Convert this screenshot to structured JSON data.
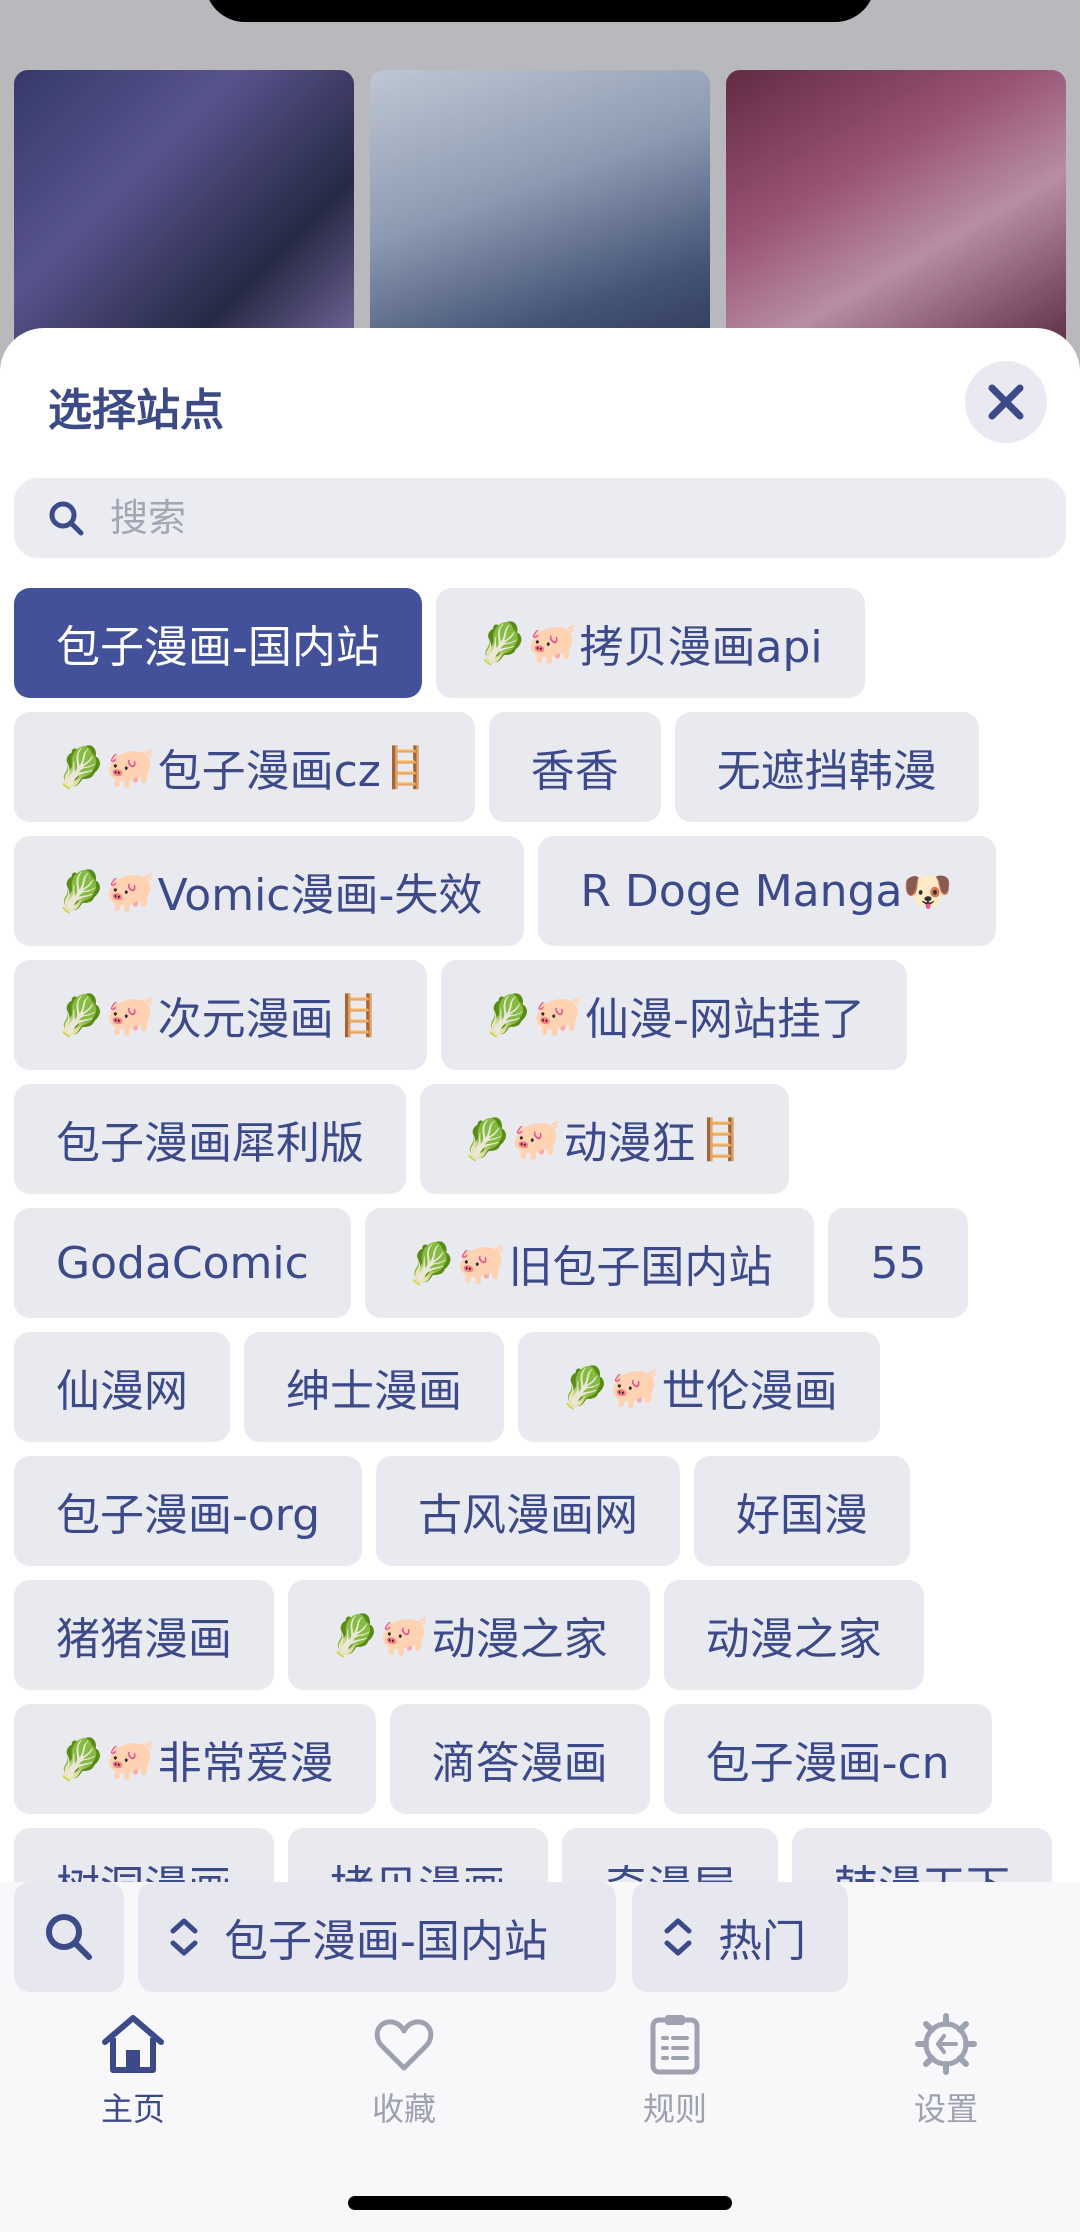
{
  "sheet": {
    "title": "选择站点",
    "search_placeholder": "搜索"
  },
  "sites": [
    {
      "label": "包子漫画-国内站",
      "prefix": "",
      "suffix": "",
      "active": true
    },
    {
      "label": "拷贝漫画api",
      "prefix": "🥬🐖",
      "suffix": ""
    },
    {
      "label": "包子漫画cz",
      "prefix": "🥬🐖",
      "suffix": "🪜"
    },
    {
      "label": "香香",
      "prefix": "",
      "suffix": ""
    },
    {
      "label": "无遮挡韩漫",
      "prefix": "",
      "suffix": ""
    },
    {
      "label": "Vomic漫画-失效",
      "prefix": "🥬🐖",
      "suffix": ""
    },
    {
      "label": "R Doge Manga",
      "prefix": "",
      "suffix": "🐶"
    },
    {
      "label": "次元漫画",
      "prefix": "🥬🐖",
      "suffix": "🪜"
    },
    {
      "label": "仙漫-网站挂了",
      "prefix": "🥬🐖",
      "suffix": ""
    },
    {
      "label": "包子漫画犀利版",
      "prefix": "",
      "suffix": ""
    },
    {
      "label": "动漫狂",
      "prefix": "🥬🐖",
      "suffix": "🪜"
    },
    {
      "label": "GodaComic",
      "prefix": "",
      "suffix": ""
    },
    {
      "label": "旧包子国内站",
      "prefix": "🥬🐖",
      "suffix": ""
    },
    {
      "label": "55",
      "prefix": "",
      "suffix": ""
    },
    {
      "label": "仙漫网",
      "prefix": "",
      "suffix": ""
    },
    {
      "label": "绅士漫画",
      "prefix": "",
      "suffix": ""
    },
    {
      "label": "世伦漫画",
      "prefix": "🥬🐖",
      "suffix": ""
    },
    {
      "label": "包子漫画-org",
      "prefix": "",
      "suffix": ""
    },
    {
      "label": "古风漫画网",
      "prefix": "",
      "suffix": ""
    },
    {
      "label": "好国漫",
      "prefix": "",
      "suffix": ""
    },
    {
      "label": "猪猪漫画",
      "prefix": "",
      "suffix": ""
    },
    {
      "label": "动漫之家",
      "prefix": "🥬🐖",
      "suffix": ""
    },
    {
      "label": "动漫之家",
      "prefix": "",
      "suffix": ""
    },
    {
      "label": "非常爱漫",
      "prefix": "🥬🐖",
      "suffix": ""
    },
    {
      "label": "滴答漫画",
      "prefix": "",
      "suffix": ""
    },
    {
      "label": "包子漫画-cn",
      "prefix": "",
      "suffix": ""
    },
    {
      "label": "树洞漫画",
      "prefix": "",
      "suffix": ""
    },
    {
      "label": "拷贝漫画",
      "prefix": "",
      "suffix": ""
    },
    {
      "label": "奇漫屋",
      "prefix": "",
      "suffix": ""
    },
    {
      "label": "韩漫天下",
      "prefix": "",
      "suffix": ""
    }
  ],
  "controls": {
    "site_select": "包子漫画-国内站",
    "sort_select": "热门"
  },
  "tabs": {
    "home": "主页",
    "favorites": "收藏",
    "rules": "规则",
    "settings": "设置"
  },
  "colors": {
    "accent": "#42519a",
    "chip_bg": "#e9eaf0",
    "inactive_tab": "#9ea1b0"
  }
}
